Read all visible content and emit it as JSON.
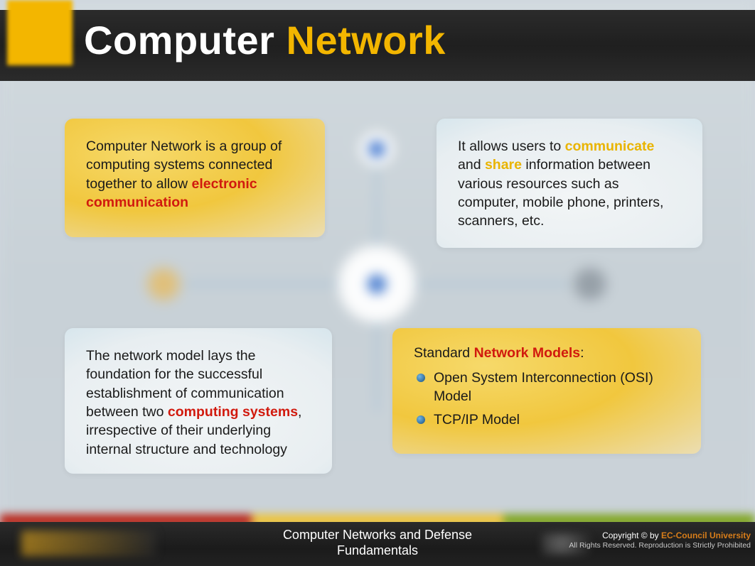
{
  "title": {
    "part1": "Computer ",
    "part2": "Network"
  },
  "cards": {
    "tl": {
      "t1": "Computer Network is a group of computing systems connected together to allow ",
      "t2": "electronic communication"
    },
    "tr": {
      "t1": "It allows users to ",
      "t2": "communicate",
      "t3": " and ",
      "t4": "share",
      "t5": " information between various resources such as computer, mobile phone, printers, scanners, etc."
    },
    "bl": {
      "t1": "The network model lays the foundation for the successful establishment of communication between two ",
      "t2": "computing systems",
      "t3": ", irrespective of their underlying internal structure and technology"
    },
    "br": {
      "title_t1": "Standard ",
      "title_t2": "Network Models",
      "title_t3": ":",
      "items": [
        "Open System Interconnection (OSI) Model",
        "TCP/IP Model"
      ]
    }
  },
  "footer": {
    "center_line1": "Computer Networks and Defense",
    "center_line2": "Fundamentals",
    "copyright_prefix": "Copyright © by ",
    "org": "EC-Council University",
    "sub": "All Rights Reserved. Reproduction is Strictly Prohibited"
  }
}
